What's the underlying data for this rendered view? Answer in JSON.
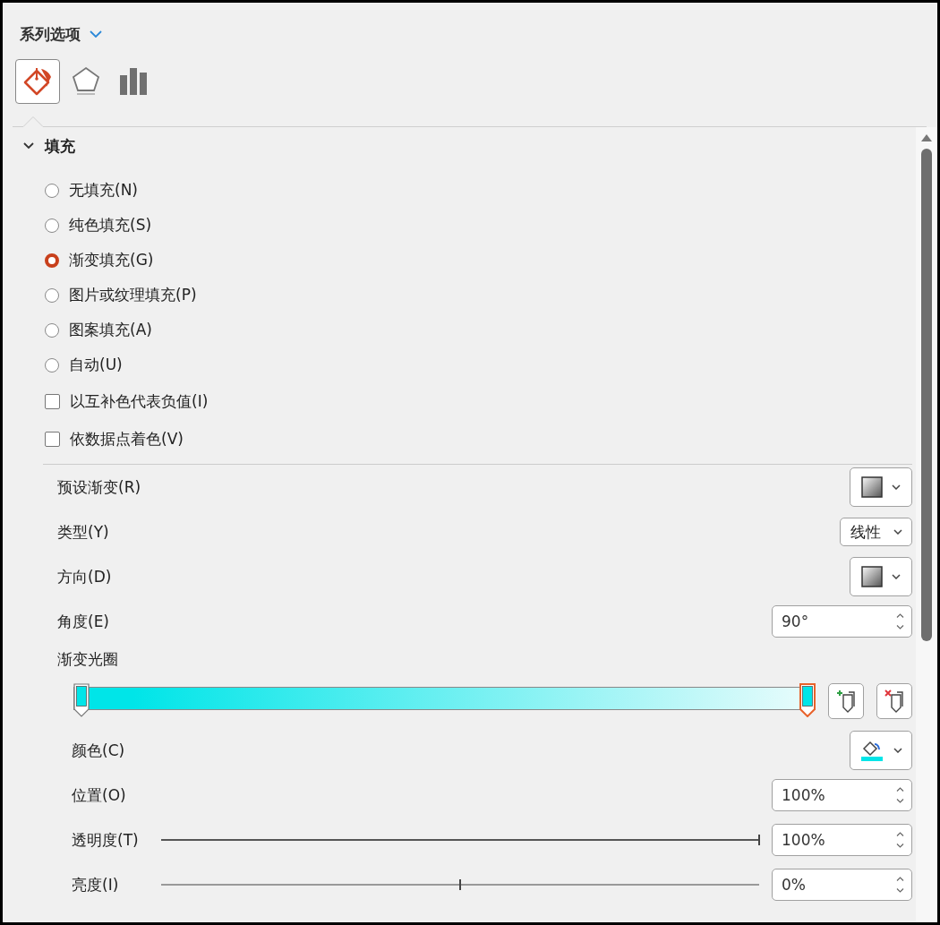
{
  "panel": {
    "title": "系列选项",
    "tabs": [
      {
        "kind": "fill",
        "selected": true
      },
      {
        "kind": "effects",
        "selected": false
      },
      {
        "kind": "series",
        "selected": false
      }
    ]
  },
  "section": {
    "title": "填充",
    "expanded": true,
    "fill_options": [
      {
        "kind": "radio",
        "label": "无填充(N)",
        "selected": false
      },
      {
        "kind": "radio",
        "label": "纯色填充(S)",
        "selected": false
      },
      {
        "kind": "radio",
        "label": "渐变填充(G)",
        "selected": true
      },
      {
        "kind": "radio",
        "label": "图片或纹理填充(P)",
        "selected": false
      },
      {
        "kind": "radio",
        "label": "图案填充(A)",
        "selected": false
      },
      {
        "kind": "radio",
        "label": "自动(U)",
        "selected": false
      },
      {
        "kind": "checkbox",
        "label": "以互补色代表负值(I)",
        "checked": false
      },
      {
        "kind": "checkbox",
        "label": "依数据点着色(V)",
        "checked": false
      }
    ],
    "preset_gradient": {
      "label": "预设渐变(R)"
    },
    "type": {
      "label": "类型(Y)",
      "value": "线性"
    },
    "direction": {
      "label": "方向(D)"
    },
    "angle": {
      "label": "角度(E)",
      "value": "90°"
    },
    "gradient_stops": {
      "label": "渐变光圈",
      "stops": [
        {
          "level": 0,
          "selected": false
        },
        {
          "level": 1,
          "selected": true
        }
      ]
    },
    "color": {
      "label": "颜色(C)",
      "color": "#00e5e8"
    },
    "position": {
      "label": "位置(O)",
      "value": "100%"
    },
    "transparency": {
      "label": "透明度(T)",
      "level": 1,
      "value": "100%"
    },
    "brightness": {
      "label": "亮度(I)",
      "level": 0.5,
      "value": "0%"
    }
  }
}
